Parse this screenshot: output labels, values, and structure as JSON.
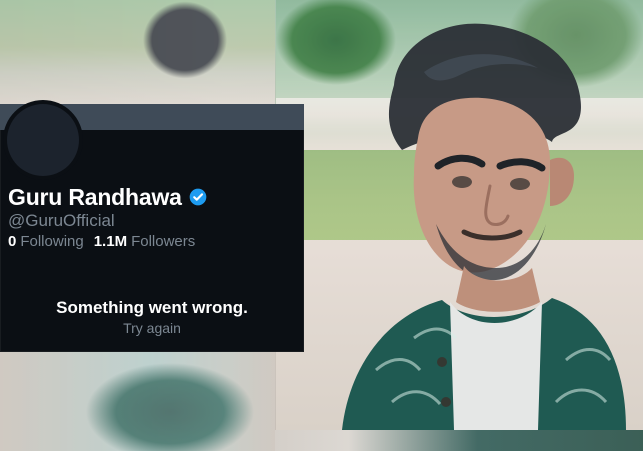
{
  "profile": {
    "display_name": "Guru Randhawa",
    "handle": "@GuruOfficial",
    "following_count": "0",
    "following_label": "Following",
    "followers_count": "1.1M",
    "followers_label": "Followers",
    "verified_badge_icon": "verified-badge-icon"
  },
  "error": {
    "title": "Something went wrong.",
    "action": "Try again"
  },
  "colors": {
    "card_background": "#0b0f14",
    "banner": "#3f4b58",
    "verified_blue": "#1d9bf0",
    "muted_text": "#7c8792",
    "text": "#ffffff"
  }
}
